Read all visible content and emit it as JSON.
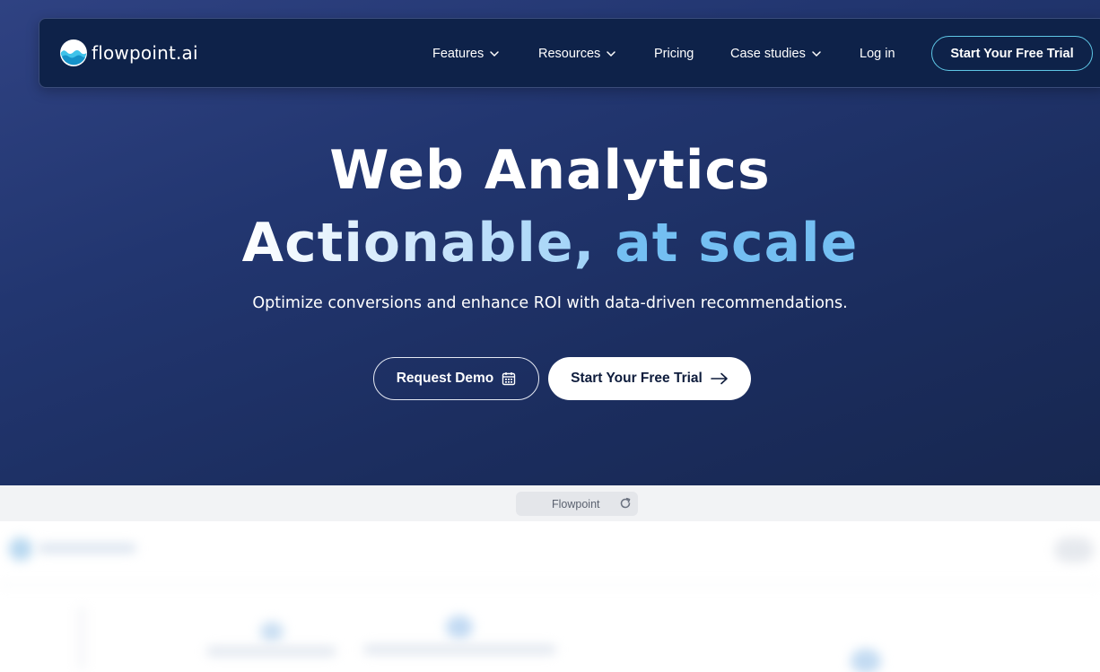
{
  "nav": {
    "brand": "flowpoint.ai",
    "items": [
      {
        "label": "Features",
        "has_dropdown": true
      },
      {
        "label": "Resources",
        "has_dropdown": true
      },
      {
        "label": "Pricing",
        "has_dropdown": false
      },
      {
        "label": "Case studies",
        "has_dropdown": true
      },
      {
        "label": "Log in",
        "has_dropdown": false
      }
    ],
    "cta_label": "Start Your Free Trial"
  },
  "hero": {
    "headline_line1": "Web Analytics",
    "headline_line2_part1": "Actionable,",
    "headline_line2_part2": "at scale",
    "subtitle": "Optimize conversions and enhance ROI with data-driven recommendations.",
    "demo_button_label": "Request Demo",
    "trial_button_label": "Start Your Free Trial"
  },
  "preview": {
    "tab_title": "Flowpoint"
  },
  "icons": {
    "logo": "wave-logo-icon",
    "dropdown": "chevron-down-icon",
    "demo": "calendar-icon",
    "trial": "arrow-right-icon",
    "reload": "refresh-icon"
  },
  "colors": {
    "hero_bg": "#223670",
    "navbar_bg": "#0e2249",
    "accent_cyan": "#5fc7e6",
    "headline_accent": "#74bff2",
    "button_text_dark": "#0e1c3c"
  }
}
